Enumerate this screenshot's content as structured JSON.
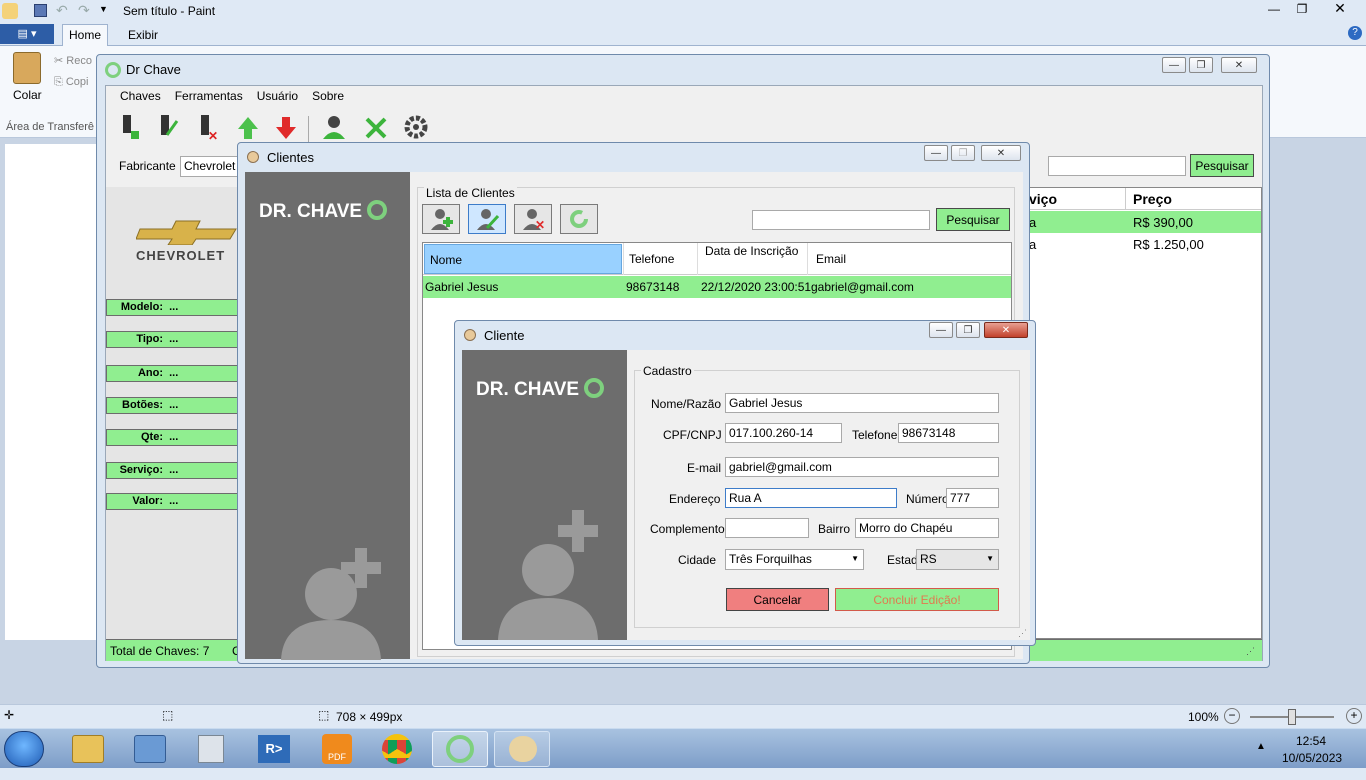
{
  "paint": {
    "title": "Sem título - Paint",
    "tabs": [
      "Home",
      "Exibir"
    ],
    "colar_label": "Colar",
    "recortar": "Reco",
    "copiar": "Copi",
    "clipboard_group": "Área de Transferê",
    "status_size": "708 × 499px",
    "zoom": "100%"
  },
  "main_window": {
    "title": "Dr Chave",
    "menu": [
      "Chaves",
      "Ferramentas",
      "Usuário",
      "Sobre"
    ],
    "fabricante_label": "Fabricante",
    "fabricante_value": "Chevrolet",
    "brand_logo": "CHEVROLET",
    "fields": [
      {
        "label": "Modelo:",
        "value": "..."
      },
      {
        "label": "Tipo:",
        "value": "..."
      },
      {
        "label": "Ano:",
        "value": "..."
      },
      {
        "label": "Botões:",
        "value": "..."
      },
      {
        "label": "Qte:",
        "value": "..."
      },
      {
        "label": "Serviço:",
        "value": "..."
      },
      {
        "label": "Valor:",
        "value": "..."
      }
    ],
    "search_button": "Pesquisar",
    "grid_headers": [
      "viço",
      "Preço"
    ],
    "grid_rows": [
      {
        "servico": "a",
        "preco": "R$ 390,00"
      },
      {
        "servico": "a",
        "preco": "R$ 1.250,00"
      }
    ],
    "status_total": "Total de Chaves:  7",
    "status_extra": "C"
  },
  "clientes": {
    "title": "Clientes",
    "logo_text": "DR. CHAVE",
    "group_title": "Lista de Clientes",
    "search_button": "Pesquisar",
    "columns": [
      "Nome",
      "Telefone",
      "Data de Inscrição",
      "Email"
    ],
    "rows": [
      {
        "nome": "Gabriel Jesus",
        "telefone": "98673148",
        "data": "22/12/2020 23:00:51",
        "email": "gabriel@gmail.com"
      }
    ]
  },
  "cliente": {
    "title": "Cliente",
    "logo_text": "DR. CHAVE",
    "group_title": "Cadastro",
    "nome_label": "Nome/Razão",
    "nome": "Gabriel Jesus",
    "cpf_label": "CPF/CNPJ",
    "cpf": "017.100.260-14",
    "telefone_label": "Telefone",
    "telefone": "98673148",
    "email_label": "E-mail",
    "email": "gabriel@gmail.com",
    "endereco_label": "Endereço",
    "endereco": "Rua A",
    "numero_label": "Número",
    "numero": "777",
    "complemento_label": "Complemento",
    "complemento": "",
    "bairro_label": "Bairro",
    "bairro": "Morro do Chapéu",
    "cidade_label": "Cidade",
    "cidade": "Três Forquilhas",
    "estado_label": "Estado",
    "estado": "RS",
    "cancel_button": "Cancelar",
    "confirm_button": "Concluir Edição!"
  },
  "taskbar": {
    "time": "12:54",
    "date": "10/05/2023"
  },
  "colors": {
    "accent_green": "#90ee90",
    "cancel_red": "#f07f7f",
    "dark_panel": "#6d6d6d",
    "selection_blue": "#99d1ff"
  }
}
